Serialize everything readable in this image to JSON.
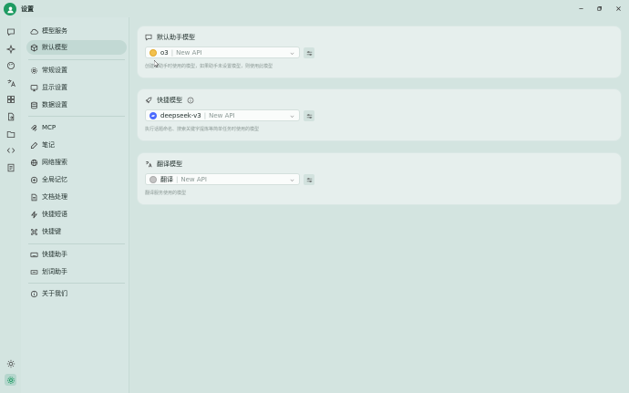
{
  "window": {
    "title": "设置",
    "controls": [
      "minimize-icon",
      "maximize-icon",
      "close-icon"
    ]
  },
  "rail": {
    "icons": [
      "chat-icon",
      "sparkle-icon",
      "palette-icon",
      "translate-icon",
      "apps-icon",
      "file-export-icon",
      "folder-icon",
      "code-icon",
      "document-icon"
    ],
    "bottom_icons": [
      "sun-icon",
      "settings-icon"
    ]
  },
  "nav": {
    "groups": [
      [
        {
          "label": "模型服务",
          "icon": "cloud-icon"
        },
        {
          "label": "默认模型",
          "icon": "cube-icon",
          "active": true
        }
      ],
      [
        {
          "label": "常规设置",
          "icon": "gear-icon"
        },
        {
          "label": "显示设置",
          "icon": "monitor-icon"
        },
        {
          "label": "数据设置",
          "icon": "database-icon"
        }
      ],
      [
        {
          "label": "MCP",
          "icon": "mcp-icon"
        },
        {
          "label": "笔记",
          "icon": "pen-icon"
        },
        {
          "label": "网络搜索",
          "icon": "globe-icon"
        },
        {
          "label": "全局记忆",
          "icon": "memory-icon"
        },
        {
          "label": "文档处理",
          "icon": "file-text-icon"
        },
        {
          "label": "快捷短语",
          "icon": "zap-icon"
        },
        {
          "label": "快捷键",
          "icon": "command-icon"
        }
      ],
      [
        {
          "label": "快捷助手",
          "icon": "keyboard-icon"
        },
        {
          "label": "划词助手",
          "icon": "text-select-icon"
        }
      ],
      [
        {
          "label": "关于我们",
          "icon": "info-icon"
        }
      ]
    ]
  },
  "cards": [
    {
      "title": "默认助手模型",
      "icon": "message-square-icon",
      "model": "o3",
      "provider": "New API",
      "model_color": "#f2c14e",
      "hint": "创建新助手时使用的模型，如果助手未设置模型，则使用此模型"
    },
    {
      "title": "快捷模型",
      "icon": "rocket-icon",
      "has_info": true,
      "model": "deepseek-v3",
      "provider": "New API",
      "model_color": "#4d6bfe",
      "hint": "执行话题命名、搜索关键字提炼等简单任务时使用的模型"
    },
    {
      "title": "翻译模型",
      "icon": "languages-icon",
      "model": "翻译",
      "provider": "New API",
      "model_color": "#b8b8b8",
      "hint": "翻译服务使用的模型"
    }
  ]
}
